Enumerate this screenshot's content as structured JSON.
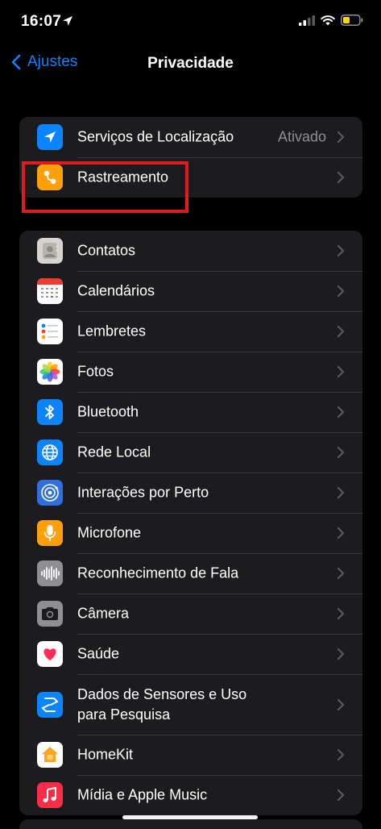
{
  "status_bar": {
    "time": "16:07",
    "battery_color": "#ffd60a"
  },
  "nav": {
    "back_label": "Ajustes",
    "title": "Privacidade"
  },
  "colors": {
    "accent": "#0a84ff",
    "highlight_box": "#e01b1b"
  },
  "location_group": [
    {
      "label": "Serviços de Localização",
      "value": "Ativado",
      "icon": "location-arrow-icon",
      "icon_color": "#0a84ff"
    },
    {
      "label": "Rastreamento",
      "value": "",
      "icon": "tracking-icon",
      "icon_color": "#ff9f0a"
    }
  ],
  "apps_group": [
    {
      "label": "Contatos",
      "icon": "contacts-icon"
    },
    {
      "label": "Calendários",
      "icon": "calendar-icon"
    },
    {
      "label": "Lembretes",
      "icon": "reminders-icon"
    },
    {
      "label": "Fotos",
      "icon": "photos-icon"
    },
    {
      "label": "Bluetooth",
      "icon": "bluetooth-icon",
      "icon_color": "#0a84ff"
    },
    {
      "label": "Rede Local",
      "icon": "globe-icon",
      "icon_color": "#0a84ff"
    },
    {
      "label": "Interações por Perto",
      "icon": "nearby-interaction-icon",
      "icon_color": "#2f6fe0"
    },
    {
      "label": "Microfone",
      "icon": "microphone-icon",
      "icon_color": "#ff9f0a"
    },
    {
      "label": "Reconhecimento de Fala",
      "icon": "speech-waveform-icon",
      "icon_color": "#8e8e93"
    },
    {
      "label": "Câmera",
      "icon": "camera-icon",
      "icon_color": "#8e8e93"
    },
    {
      "label": "Saúde",
      "icon": "health-heart-icon",
      "icon_color": "#ffffff"
    },
    {
      "label": "Dados de Sensores e Uso para Pesquisa",
      "icon": "research-icon",
      "icon_color": "#0a84ff"
    },
    {
      "label": "HomeKit",
      "icon": "homekit-icon",
      "icon_color": "#ffffff"
    },
    {
      "label": "Mídia e Apple Music",
      "icon": "music-note-icon",
      "icon_color": "#fa2d48"
    }
  ]
}
